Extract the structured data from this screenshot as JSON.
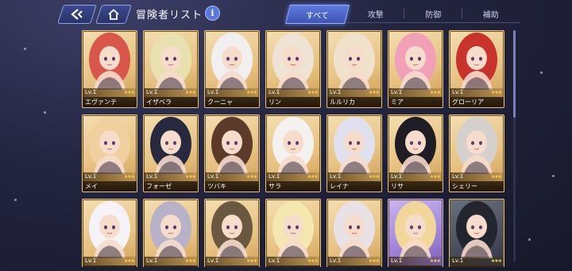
{
  "header": {
    "title": "冒険者リスト",
    "help": "i"
  },
  "tabs": [
    "すべて",
    "攻撃",
    "防御",
    "補助"
  ],
  "active_tab": 0,
  "cards": [
    {
      "level": "Lv.1",
      "name": "エヴァンテ",
      "hair": "#d9574a",
      "theme": "gold"
    },
    {
      "level": "Lv.1",
      "name": "イザベラ",
      "hair": "#e9e0b0",
      "theme": "gold"
    },
    {
      "level": "Lv.1",
      "name": "クーニャ",
      "hair": "#f0f0f0",
      "theme": "gold"
    },
    {
      "level": "Lv.1",
      "name": "リン",
      "hair": "#efe3d6",
      "theme": "gold"
    },
    {
      "level": "Lv.1",
      "name": "ルルリカ",
      "hair": "#f0e2cc",
      "theme": "gold"
    },
    {
      "level": "Lv.1",
      "name": "ミア",
      "hair": "#f2a0b8",
      "theme": "gold"
    },
    {
      "level": "Lv.1",
      "name": "グローリア",
      "hair": "#c8342b",
      "theme": "gold"
    },
    {
      "level": "Lv.1",
      "name": "メイ",
      "hair": "#f1d0a0",
      "theme": "gold"
    },
    {
      "level": "Lv.1",
      "name": "フォーゼ",
      "hair": "#272a3f",
      "theme": "gold"
    },
    {
      "level": "Lv.1",
      "name": "ツバキ",
      "hair": "#5c3b2a",
      "theme": "gold"
    },
    {
      "level": "Lv.1",
      "name": "サラ",
      "hair": "#f4f2ee",
      "theme": "gold"
    },
    {
      "level": "Lv.1",
      "name": "レイナ",
      "hair": "#dfe2ee",
      "theme": "gold"
    },
    {
      "level": "Lv.1",
      "name": "リサ",
      "hair": "#1f1d24",
      "theme": "gold"
    },
    {
      "level": "Lv.1",
      "name": "シェリー",
      "hair": "#d4d0cc",
      "theme": "gold"
    },
    {
      "level": "Lv.1",
      "name": "",
      "hair": "#f5f3f6",
      "theme": "gold"
    },
    {
      "level": "Lv.1",
      "name": "",
      "hair": "#b8b2c8",
      "theme": "gold"
    },
    {
      "level": "Lv.1",
      "name": "",
      "hair": "#6b5840",
      "theme": "gold"
    },
    {
      "level": "Lv.1",
      "name": "",
      "hair": "#f5e7b0",
      "theme": "gold"
    },
    {
      "level": "Lv.1",
      "name": "",
      "hair": "#e8e2e6",
      "theme": "gold"
    },
    {
      "level": "Lv.1",
      "name": "",
      "hair": "#f3d79a",
      "theme": "purple"
    },
    {
      "level": "Lv.1",
      "name": "",
      "hair": "#23252f",
      "theme": "dark"
    }
  ],
  "stars": "★★★"
}
